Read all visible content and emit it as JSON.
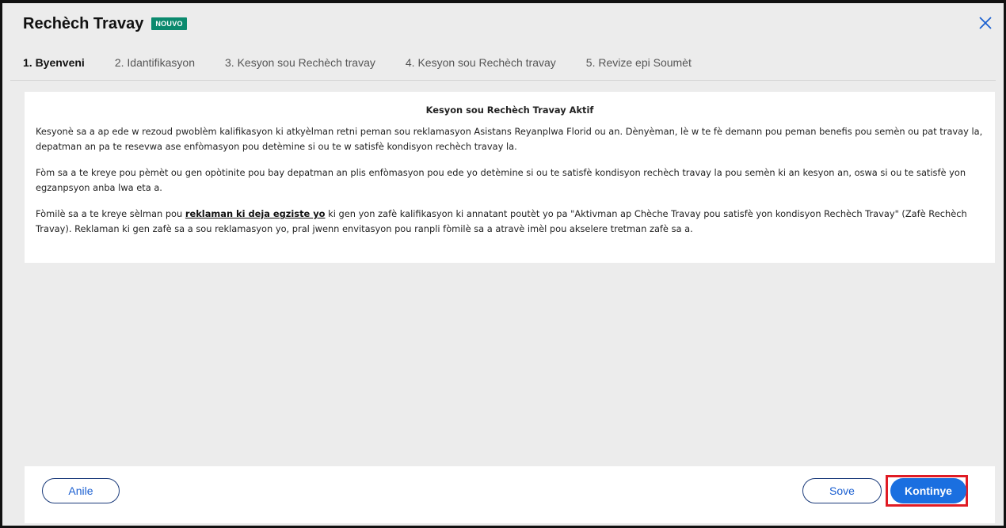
{
  "header": {
    "title": "Rechèch Travay",
    "badge": "NOUVO"
  },
  "tabs": [
    {
      "label": "1. Byenveni",
      "active": true
    },
    {
      "label": "2. Idantifikasyon",
      "active": false
    },
    {
      "label": "3. Kesyon sou Rechèch travay",
      "active": false
    },
    {
      "label": "4. Kesyon sou Rechèch travay",
      "active": false
    },
    {
      "label": "5. Revize epi Soumèt",
      "active": false
    }
  ],
  "content": {
    "heading": "Kesyon sou Rechèch Travay Aktif",
    "p1": "Kesyonè sa a ap ede w rezoud pwoblèm kalifikasyon ki atkyèlman retni peman sou reklamasyon Asistans Reyanplwa Florid ou an. Dènyèman, lè w te fè demann pou peman benefis pou semèn ou pat travay la, depatman an pa te resevwa ase enfòmasyon pou detèmine si ou te w satisfè kondisyon rechèch travay la.",
    "p2": "Fòm sa a te kreye pou pèmèt ou gen opòtinite pou bay depatman an plis enfòmasyon pou ede yo detèmine si ou te satisfè kondisyon rechèch travay la pou semèn ki an kesyon an, oswa si ou te satisfè yon egzanpsyon anba lwa eta a.",
    "p3_before": "Fòmilè sa a te kreye sèlman pou ",
    "p3_link": "reklaman ki deja egziste yo",
    "p3_after": " ki gen yon zafè kalifikasyon ki annatant poutèt yo pa \"Aktivman ap Chèche Travay pou satisfè yon kondisyon Rechèch Travay\" (Zafè Rechèch Travay). Reklaman ki gen zafè sa a sou reklamasyon yo, pral jwenn envitasyon pou ranpli fòmilè sa a atravè imèl pou akselere tretman zafè sa a."
  },
  "footer": {
    "cancel_label": "Anile",
    "save_label": "Sove",
    "continue_label": "Kontinye"
  },
  "colors": {
    "badge": "#0b8a6e",
    "primary": "#1a6fe0",
    "highlight": "#e01b24"
  }
}
